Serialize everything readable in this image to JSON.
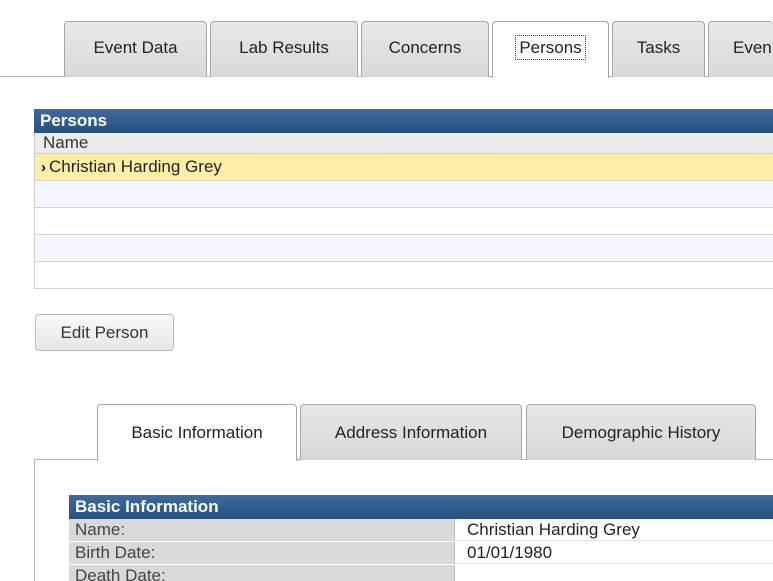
{
  "top_tabs": [
    {
      "label": "Event Data",
      "active": false
    },
    {
      "label": "Lab Results",
      "active": false
    },
    {
      "label": "Concerns",
      "active": false
    },
    {
      "label": "Persons",
      "active": true
    },
    {
      "label": "Tasks",
      "active": false
    },
    {
      "label": "Even",
      "active": false
    }
  ],
  "persons_grid": {
    "title": "Persons",
    "column_header": "Name",
    "rows": [
      {
        "name": "Christian Harding Grey",
        "selected": true
      }
    ],
    "selected_marker": "›"
  },
  "edit_person_label": "Edit Person",
  "sub_tabs": [
    {
      "label": "Basic Information",
      "active": true
    },
    {
      "label": "Address Information",
      "active": false
    },
    {
      "label": "Demographic History",
      "active": false
    }
  ],
  "basic_info": {
    "title": "Basic Information",
    "fields": [
      {
        "label": "Name:",
        "value": "Christian Harding Grey"
      },
      {
        "label": "Birth Date:",
        "value": "01/01/1980"
      },
      {
        "label": "Death Date:",
        "value": ""
      }
    ]
  },
  "colors": {
    "header_blue": "#2f5b8b",
    "selected_row": "#fdf0a6",
    "alt_row": "#f3f6ff"
  }
}
